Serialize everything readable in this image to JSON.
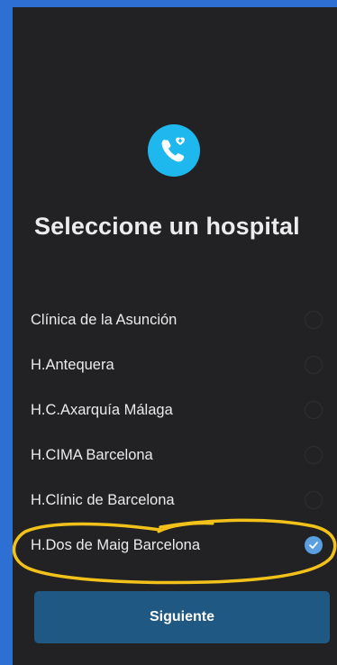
{
  "screen": {
    "title": "Seleccione un hospital",
    "app_icon": "phone-heart-icon",
    "accent_color": "#1fb8ee",
    "background_color": "#222224"
  },
  "hospitals": [
    {
      "name": "Clínica de la Asunción",
      "selected": false
    },
    {
      "name": "H.Antequera",
      "selected": false
    },
    {
      "name": "H.C.Axarquía Málaga",
      "selected": false
    },
    {
      "name": "H.CIMA Barcelona",
      "selected": false
    },
    {
      "name": "H.Clínic de Barcelona",
      "selected": false
    },
    {
      "name": "H.Dos de Maig Barcelona",
      "selected": true
    }
  ],
  "next_button": {
    "label": "Siguiente",
    "color": "#1f5882"
  },
  "annotation": {
    "type": "hand-drawn-ellipse",
    "color": "#f2c21a"
  }
}
